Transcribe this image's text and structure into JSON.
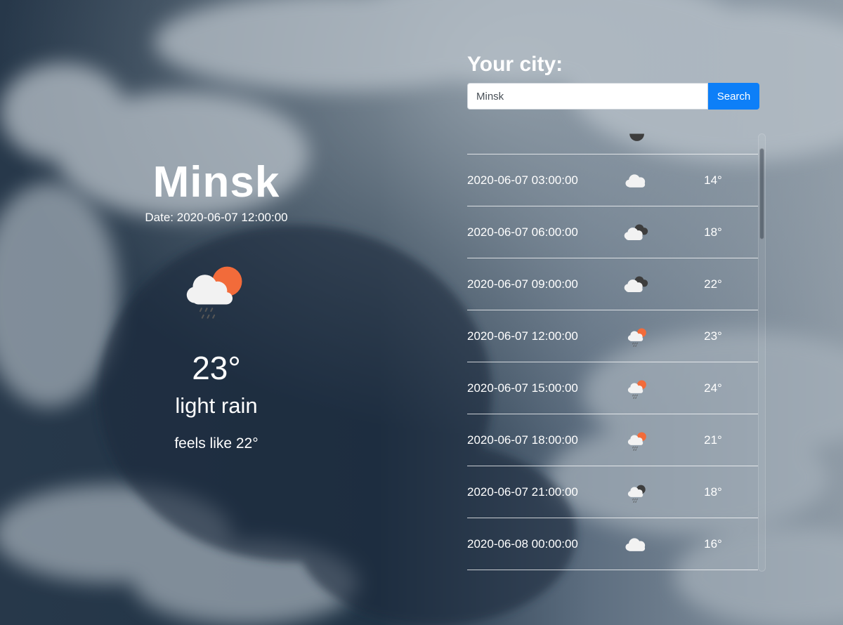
{
  "current": {
    "city": "Minsk",
    "date": "Date: 2020-06-07 12:00:00",
    "icon": "light-rain-sun-icon",
    "temperature": "23°",
    "description": "light rain",
    "feels_like": "feels like 22°"
  },
  "search": {
    "title": "Your city:",
    "value": "Minsk",
    "button_label": "Search"
  },
  "forecast": [
    {
      "datetime": "",
      "icon": "night-partial-icon",
      "temp": ""
    },
    {
      "datetime": "2020-06-07 03:00:00",
      "icon": "cloud-icon",
      "temp": "14°"
    },
    {
      "datetime": "2020-06-07 06:00:00",
      "icon": "broken-clouds-icon",
      "temp": "18°"
    },
    {
      "datetime": "2020-06-07 09:00:00",
      "icon": "broken-clouds-icon",
      "temp": "22°"
    },
    {
      "datetime": "2020-06-07 12:00:00",
      "icon": "light-rain-sun-icon",
      "temp": "23°"
    },
    {
      "datetime": "2020-06-07 15:00:00",
      "icon": "light-rain-sun-icon",
      "temp": "24°"
    },
    {
      "datetime": "2020-06-07 18:00:00",
      "icon": "light-rain-sun-icon",
      "temp": "21°"
    },
    {
      "datetime": "2020-06-07 21:00:00",
      "icon": "light-rain-night-icon",
      "temp": "18°"
    },
    {
      "datetime": "2020-06-08 00:00:00",
      "icon": "cloud-icon",
      "temp": "16°"
    }
  ],
  "colors": {
    "accent": "#0d7ff8",
    "sun": "#f26b3a",
    "cloud": "#f2f2f2",
    "dark_cloud": "#3d3d3d"
  }
}
